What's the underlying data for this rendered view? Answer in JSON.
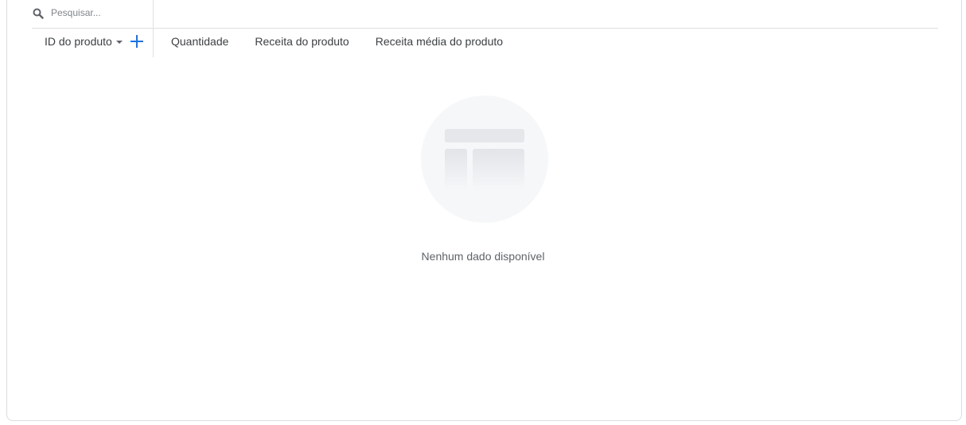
{
  "search": {
    "placeholder": "Pesquisar...",
    "icon": "search-icon"
  },
  "table": {
    "dimension_header": "ID do produto",
    "add_dimension_icon": "plus-icon",
    "metric_headers": [
      "Quantidade",
      "Receita do produto",
      "Receita média do produto"
    ]
  },
  "empty_state": {
    "icon": "table-placeholder-icon",
    "message": "Nenhum dado disponível"
  },
  "colors": {
    "accent": "#1a73e8",
    "border": "#dadce0",
    "text": "#3c4043",
    "muted": "#5f6368",
    "placeholder_bg": "#f6f7f9"
  }
}
